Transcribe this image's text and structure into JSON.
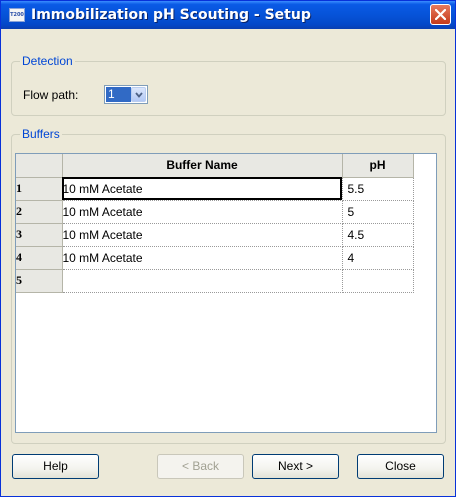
{
  "window": {
    "icon_text": "T200",
    "title": "Immobilization pH Scouting - Setup"
  },
  "detection": {
    "legend": "Detection",
    "flow_path_label": "Flow path:",
    "flow_path_value": "1"
  },
  "buffers": {
    "legend": "Buffers",
    "columns": [
      "Buffer Name",
      "pH"
    ],
    "rows": [
      {
        "num": "1",
        "name": "10 mM Acetate",
        "ph": "5.5"
      },
      {
        "num": "2",
        "name": "10 mM Acetate",
        "ph": "5"
      },
      {
        "num": "3",
        "name": "10 mM Acetate",
        "ph": "4.5"
      },
      {
        "num": "4",
        "name": "10 mM Acetate",
        "ph": "4"
      },
      {
        "num": "5",
        "name": "",
        "ph": ""
      }
    ]
  },
  "buttons": {
    "help": "Help",
    "back": "< Back",
    "next": "Next >",
    "close": "Close"
  },
  "colors": {
    "title_bar": "#0653d8",
    "legend_text": "#0046d5",
    "selection": "#316ac5",
    "close_button": "#c4391a"
  }
}
